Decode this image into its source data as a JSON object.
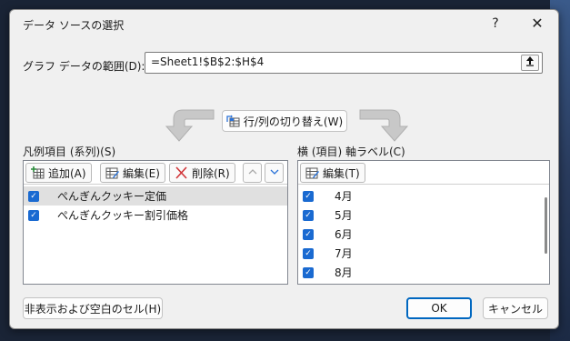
{
  "dialog": {
    "title": "データ ソースの選択",
    "help": "?",
    "close": "✕"
  },
  "range": {
    "label": "グラフ データの範囲(D):",
    "value": "=Sheet1!$B$2:$H$4"
  },
  "switch_button": "行/列の切り替え(W)",
  "legend": {
    "label": "凡例項目 (系列)(S)",
    "add": "追加(A)",
    "edit": "編集(E)",
    "delete": "削除(R)",
    "items": [
      {
        "label": "ぺんぎんクッキー定価",
        "checked": true,
        "selected": true
      },
      {
        "label": "ぺんぎんクッキー割引価格",
        "checked": true,
        "selected": false
      }
    ]
  },
  "axis": {
    "label": "横 (項目) 軸ラベル(C)",
    "edit": "編集(T)",
    "items": [
      {
        "label": "4月",
        "checked": true
      },
      {
        "label": "5月",
        "checked": true
      },
      {
        "label": "6月",
        "checked": true
      },
      {
        "label": "7月",
        "checked": true
      },
      {
        "label": "8月",
        "checked": true
      }
    ]
  },
  "footer": {
    "hidden_cells": "非表示および空白のセル(H)",
    "ok": "OK",
    "cancel": "キャンセル"
  },
  "colors": {
    "accent": "#0067c0",
    "checkbox": "#1a6ad1",
    "delete_icon": "#d13438"
  }
}
